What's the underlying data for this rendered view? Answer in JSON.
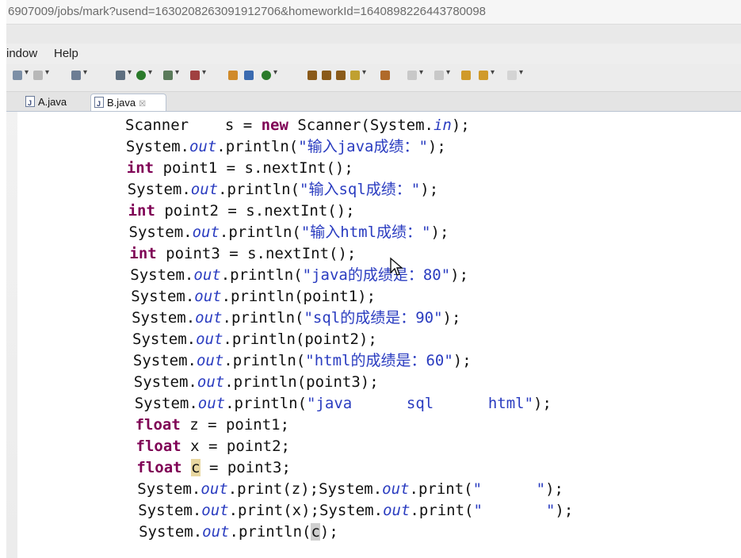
{
  "url_text": "6907009/jobs/mark?usend=1630208263091912706&homeworkId=1640898226443780098",
  "menu": [
    "indow",
    "Help"
  ],
  "tabs": [
    {
      "label": "A.java",
      "active": false
    },
    {
      "label": "B.java",
      "active": true,
      "close": "☒"
    }
  ],
  "code_lines": [
    {
      "segs": [
        {
          "t": "Scanner    s = "
        },
        {
          "t": "new",
          "c": "kw"
        },
        {
          "t": " Scanner(System."
        },
        {
          "t": "in",
          "c": "fld"
        },
        {
          "t": ");"
        }
      ]
    },
    {
      "segs": [
        {
          "t": "System."
        },
        {
          "t": "out",
          "c": "fld"
        },
        {
          "t": ".println("
        },
        {
          "t": "\"输入java成绩：\"",
          "c": "str"
        },
        {
          "t": ");"
        }
      ]
    },
    {
      "segs": [
        {
          "t": "int",
          "c": "kw"
        },
        {
          "t": " point1 = s.nextInt();"
        }
      ]
    },
    {
      "segs": [
        {
          "t": "System."
        },
        {
          "t": "out",
          "c": "fld"
        },
        {
          "t": ".println("
        },
        {
          "t": "\"输入sql成绩：\"",
          "c": "str"
        },
        {
          "t": ");"
        }
      ]
    },
    {
      "segs": [
        {
          "t": "int",
          "c": "kw"
        },
        {
          "t": " point2 = s.nextInt();"
        }
      ]
    },
    {
      "segs": [
        {
          "t": "System."
        },
        {
          "t": "out",
          "c": "fld"
        },
        {
          "t": ".println("
        },
        {
          "t": "\"输入html成绩：\"",
          "c": "str"
        },
        {
          "t": ");"
        }
      ]
    },
    {
      "segs": [
        {
          "t": "int",
          "c": "kw"
        },
        {
          "t": " point3 = s.nextInt();"
        }
      ]
    },
    {
      "segs": [
        {
          "t": "System."
        },
        {
          "t": "out",
          "c": "fld"
        },
        {
          "t": ".println("
        },
        {
          "t": "\"java的成绩是：80\"",
          "c": "str"
        },
        {
          "t": ");"
        }
      ]
    },
    {
      "segs": [
        {
          "t": "System."
        },
        {
          "t": "out",
          "c": "fld"
        },
        {
          "t": ".println(point1);"
        }
      ]
    },
    {
      "segs": [
        {
          "t": "System."
        },
        {
          "t": "out",
          "c": "fld"
        },
        {
          "t": ".println("
        },
        {
          "t": "\"sql的成绩是：90\"",
          "c": "str"
        },
        {
          "t": ");"
        }
      ]
    },
    {
      "segs": [
        {
          "t": "System."
        },
        {
          "t": "out",
          "c": "fld"
        },
        {
          "t": ".println(point2);"
        }
      ]
    },
    {
      "segs": [
        {
          "t": "System."
        },
        {
          "t": "out",
          "c": "fld"
        },
        {
          "t": ".println("
        },
        {
          "t": "\"html的成绩是：60\"",
          "c": "str"
        },
        {
          "t": ");"
        }
      ]
    },
    {
      "segs": [
        {
          "t": "System."
        },
        {
          "t": "out",
          "c": "fld"
        },
        {
          "t": ".println(point3);"
        }
      ]
    },
    {
      "segs": [
        {
          "t": "System."
        },
        {
          "t": "out",
          "c": "fld"
        },
        {
          "t": ".println("
        },
        {
          "t": "\"java      sql      html\"",
          "c": "str"
        },
        {
          "t": ");"
        }
      ]
    },
    {
      "segs": [
        {
          "t": "float",
          "c": "kw"
        },
        {
          "t": " z = point1;"
        }
      ]
    },
    {
      "segs": [
        {
          "t": "float",
          "c": "kw"
        },
        {
          "t": " x = point2;"
        }
      ]
    },
    {
      "segs": [
        {
          "t": "float",
          "c": "kw"
        },
        {
          "t": " "
        },
        {
          "t": "c",
          "c": "hl"
        },
        {
          "t": " = point3;"
        }
      ]
    },
    {
      "segs": [
        {
          "t": "System."
        },
        {
          "t": "out",
          "c": "fld"
        },
        {
          "t": ".print(z);System."
        },
        {
          "t": "out",
          "c": "fld"
        },
        {
          "t": ".print("
        },
        {
          "t": "\"      \"",
          "c": "str"
        },
        {
          "t": ");"
        }
      ]
    },
    {
      "segs": [
        {
          "t": "System."
        },
        {
          "t": "out",
          "c": "fld"
        },
        {
          "t": ".print(x);System."
        },
        {
          "t": "out",
          "c": "fld"
        },
        {
          "t": ".print("
        },
        {
          "t": "\"       \"",
          "c": "str"
        },
        {
          "t": ");"
        }
      ]
    },
    {
      "segs": [
        {
          "t": "System."
        },
        {
          "t": "out",
          "c": "fld"
        },
        {
          "t": ".println("
        },
        {
          "t": "c",
          "c": "caret"
        },
        {
          "t": ");"
        }
      ]
    }
  ]
}
